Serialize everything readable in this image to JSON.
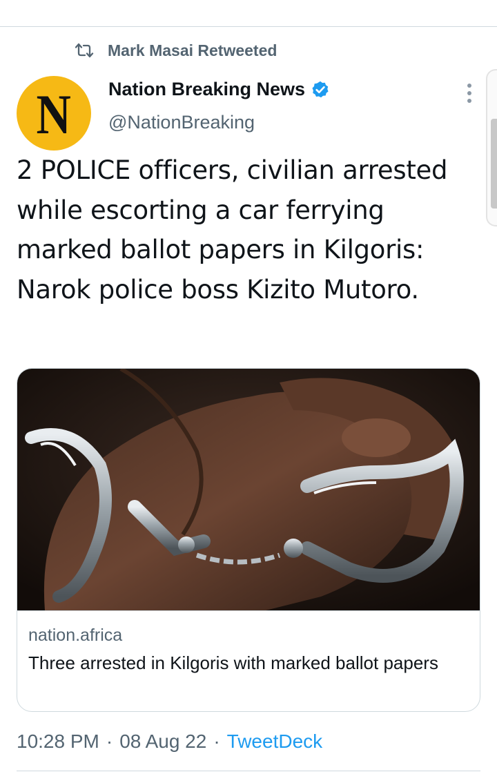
{
  "retweet": {
    "label": "Mark Masai Retweeted"
  },
  "author": {
    "avatar_letter": "N",
    "display_name": "Nation Breaking News",
    "handle": "@NationBreaking"
  },
  "tweet": {
    "text": "2 POLICE officers, civilian arrested while escorting a car ferrying marked ballot papers in Kilgoris: Narok police boss Kizito Mutoro."
  },
  "card": {
    "image_alt": "Handcuffed hands",
    "domain": "nation.africa",
    "title": "Three arrested in Kilgoris with marked ballot papers"
  },
  "meta": {
    "time": "10:28 PM",
    "separator": "·",
    "date": "08 Aug 22",
    "source": "TweetDeck"
  },
  "colors": {
    "accent": "#1d9bf0",
    "secondary_text": "#536471",
    "avatar_bg": "#f6b915"
  },
  "icons": {
    "retweet": "retweet-icon",
    "verified": "verified-badge-icon",
    "more": "more-options-icon"
  }
}
